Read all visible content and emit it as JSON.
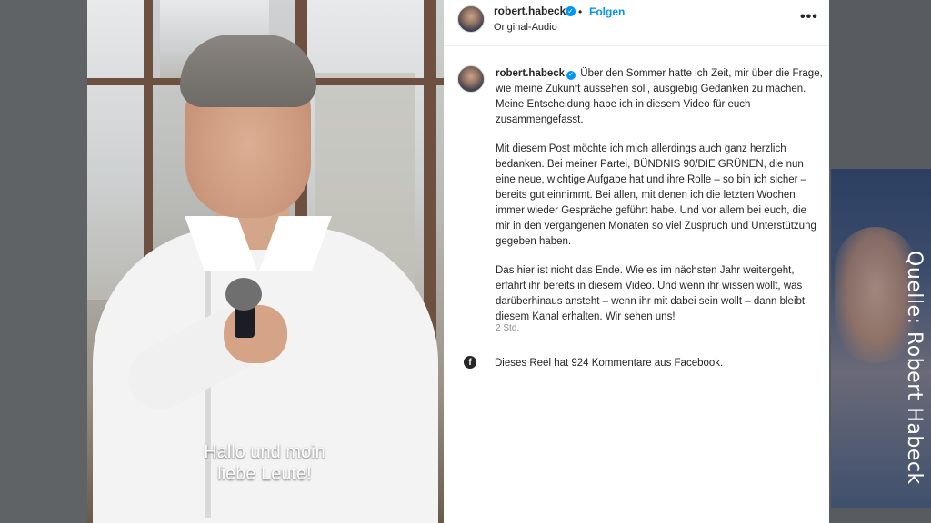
{
  "source_credit": "Quelle: Robert Habeck",
  "video": {
    "subtitle_line1": "Hallo und moin",
    "subtitle_line2": "liebe Leute!"
  },
  "post": {
    "header": {
      "username": "robert.habeck",
      "separator": "•",
      "follow_label": "Folgen",
      "audio_label": "Original-Audio",
      "more_label": "•••"
    },
    "caption": {
      "username": "robert.habeck",
      "paragraph1": "Über den Sommer hatte ich Zeit, mir über die Frage, wie meine Zukunft aussehen soll, ausgiebig Gedanken zu machen. Meine Entscheidung habe ich in diesem Video für euch zusammengefasst.",
      "paragraph2": "Mit diesem Post möchte ich mich allerdings auch ganz herzlich bedanken. Bei meiner Partei, BÜNDNIS 90/DIE GRÜNEN, die nun eine neue, wichtige Aufgabe hat und ihre Rolle – so bin ich sicher – bereits gut einnimmt. Bei allen, mit denen ich die letzten Wochen immer wieder Gespräche geführt habe. Und vor allem bei euch, die mir in den vergangenen Monaten so viel Zuspruch und Unterstützung gegeben haben.",
      "paragraph3": "Das hier ist nicht das Ende. Wie es im nächsten Jahr weitergeht, erfahrt ihr bereits in diesem Video. Und wenn ihr wissen wollt, was darüberhinaus ansteht – wenn ihr mit dabei sein wollt – dann bleibt diesem Kanal erhalten. Wir sehen uns!",
      "time_ago": "2 Std."
    },
    "facebook_note": "Dieses Reel hat 924 Kommentare aus Facebook.",
    "icons": {
      "verified": "verified-check-icon",
      "more": "more-options-icon",
      "facebook": "facebook-icon"
    },
    "colors": {
      "link_blue": "#0095f6",
      "text": "#262626",
      "muted": "#8e8e8e"
    }
  }
}
